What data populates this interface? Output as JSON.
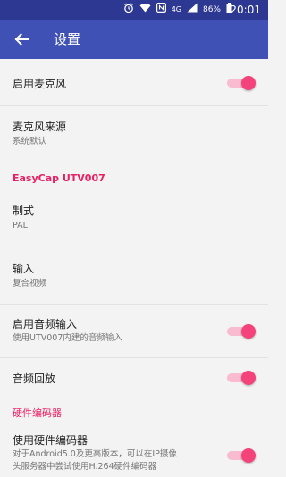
{
  "status_bar": {
    "network": "4G",
    "battery_percent": "86%",
    "time": "20:01",
    "icons": [
      "alarm-icon",
      "wifi-icon",
      "nfc-icon",
      "signal-icon",
      "battery-icon"
    ]
  },
  "toolbar": {
    "title": "设置",
    "back_icon": "arrow-left-icon"
  },
  "colors": {
    "status_bar": "#2d3892",
    "toolbar": "#3f51b5",
    "accent": "#e91e63",
    "switch_thumb": "#f3437a",
    "switch_track": "#f8bbd0"
  },
  "settings": {
    "enable_mic": {
      "label": "启用麦克风",
      "checked": true
    },
    "mic_source": {
      "label": "麦克风来源",
      "summary": "系统默认"
    },
    "section_easycap": "EasyCap UTV007",
    "standard": {
      "label": "制式",
      "summary": "PAL"
    },
    "input": {
      "label": "输入",
      "summary": "复合视频"
    },
    "enable_audio_input": {
      "label": "启用音频输入",
      "summary": "使用UTV007内建的音频输入",
      "checked": true
    },
    "audio_playback": {
      "label": "音频回放",
      "checked": true
    },
    "section_hw_encoder": "硬件编码器",
    "use_hw_encoder": {
      "label": "使用硬件编码器",
      "summary_line1": "对于Android5.0及更高版本，可以在IP摄像",
      "summary_line2": "头服务器中尝试使用H.264硬件编码器",
      "checked": true
    }
  }
}
